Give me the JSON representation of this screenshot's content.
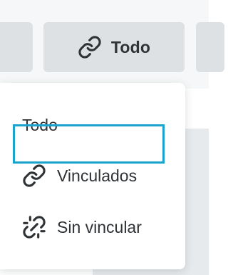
{
  "filter_tabs": {
    "active_label": "Todo",
    "active_icon": "link-icon"
  },
  "dropdown": {
    "items": [
      {
        "label": "Todo",
        "icon": null
      },
      {
        "label": "Vinculados",
        "icon": "link-icon"
      },
      {
        "label": "Sin vincular",
        "icon": "unlink-icon",
        "focused": true
      }
    ]
  },
  "colors": {
    "tab_background": "#dde1e4",
    "text": "#2f3336",
    "focus_ring": "#1aa3cc"
  }
}
